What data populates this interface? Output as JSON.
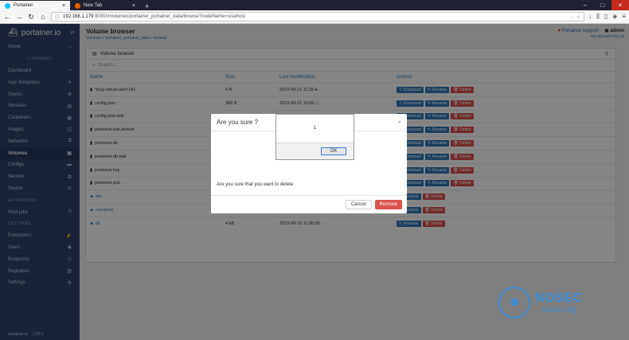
{
  "browser": {
    "tabs": [
      {
        "label": "Portainer",
        "active": true
      },
      {
        "label": "New Tab",
        "active": false
      }
    ],
    "url_host": "192.168.1.179",
    "url_rest": ":9000/#/volumes/portainer_portainer_data/browse?nodeName=sisahost"
  },
  "sidebar": {
    "brand": "portainer.io",
    "items_top": [
      {
        "label": "Home",
        "icon": "⌂"
      }
    ],
    "primary_title": "≡ PRIMARY",
    "items_primary": [
      {
        "label": "Dashboard",
        "icon": "◔",
        "active": false
      },
      {
        "label": "App Templates",
        "icon": "✈",
        "active": false
      },
      {
        "label": "Stacks",
        "icon": "≣",
        "active": false
      },
      {
        "label": "Services",
        "icon": "▤",
        "active": false
      },
      {
        "label": "Containers",
        "icon": "▦",
        "active": false
      },
      {
        "label": "Images",
        "icon": "◫",
        "active": false
      },
      {
        "label": "Networks",
        "icon": "⧉",
        "active": false
      },
      {
        "label": "Volumes",
        "icon": "▣",
        "active": true
      },
      {
        "label": "Configs",
        "icon": "▬",
        "active": false
      },
      {
        "label": "Secrets",
        "icon": "✪",
        "active": false
      },
      {
        "label": "Swarm",
        "icon": "◎",
        "active": false
      }
    ],
    "extensions_title": "EXTENSIONS",
    "items_ext": [
      {
        "label": "Host jobs",
        "icon": "⏱"
      }
    ],
    "settings_title": "SETTINGS",
    "items_settings": [
      {
        "label": "Extensions",
        "icon": "⚡"
      },
      {
        "label": "Users",
        "icon": "◉"
      },
      {
        "label": "Endpoints",
        "icon": "⎔"
      },
      {
        "label": "Registries",
        "icon": "▥"
      },
      {
        "label": "Settings",
        "icon": "⚙"
      }
    ],
    "footer_brand": "portainer.io",
    "footer_version": "1.20.1"
  },
  "header": {
    "title": "Volume browser",
    "breadcrumb": "Volumes > portainer_portainer_data > browse",
    "support": "Portainer support",
    "user": "admin",
    "links": "my account  log out"
  },
  "panel": {
    "title": "Volume browser",
    "search_placeholder": "Search...",
    "columns": [
      "Name",
      "Size",
      "Last modification",
      "Actions"
    ],
    "rows": [
      {
        "name": "*bug-robust-alert-DH",
        "size": "4 B",
        "modified": "2019-09-21 11:28 ●",
        "dir": false,
        "actions": [
          "Download",
          "Rename",
          "Delete"
        ]
      },
      {
        "name": "config.json",
        "size": "389 B",
        "modified": "2019-09-21 10:00 □",
        "dir": false,
        "actions": [
          "Download",
          "Rename",
          "Delete"
        ]
      },
      {
        "name": "config.json.bak",
        "size": "",
        "modified": "",
        "dir": false,
        "actions": [
          "Download",
          "Rename",
          "Delete"
        ]
      },
      {
        "name": "portainer.bak.default",
        "size": "",
        "modified": "",
        "dir": false,
        "actions": [
          "Download",
          "Rename",
          "Delete"
        ]
      },
      {
        "name": "portainer.db",
        "size": "",
        "modified": "",
        "dir": false,
        "actions": [
          "Download",
          "Rename",
          "Delete"
        ]
      },
      {
        "name": "portainer.db.bak",
        "size": "",
        "modified": "",
        "dir": false,
        "actions": [
          "Download",
          "Rename",
          "Delete"
        ]
      },
      {
        "name": "portainer.key",
        "size": "",
        "modified": "",
        "dir": false,
        "actions": [
          "Download",
          "Rename",
          "Delete"
        ]
      },
      {
        "name": "portainer.pub",
        "size": "",
        "modified": "",
        "dir": false,
        "actions": [
          "Download",
          "Rename",
          "Delete"
        ]
      },
      {
        "name": "bin",
        "size": "",
        "modified": "",
        "dir": true,
        "actions": [
          "Rename",
          "Delete"
        ]
      },
      {
        "name": "compose",
        "size": "4 kB",
        "modified": "2019-09-21 12:16:56",
        "dir": true,
        "actions": [
          "Rename",
          "Delete"
        ]
      },
      {
        "name": "tls",
        "size": "4 kB",
        "modified": "2019-09-19 11:36:56",
        "dir": true,
        "actions": [
          "Rename",
          "Delete"
        ]
      }
    ]
  },
  "modal": {
    "title": "Are you sure ?",
    "close": "×",
    "body": "Are you sure that you want to delete",
    "cancel": "Cancel",
    "remove": "Remove"
  },
  "alert": {
    "message": "1",
    "ok": "OK"
  },
  "watermark": {
    "big": "NOSEC",
    "small": "nosec.org"
  }
}
